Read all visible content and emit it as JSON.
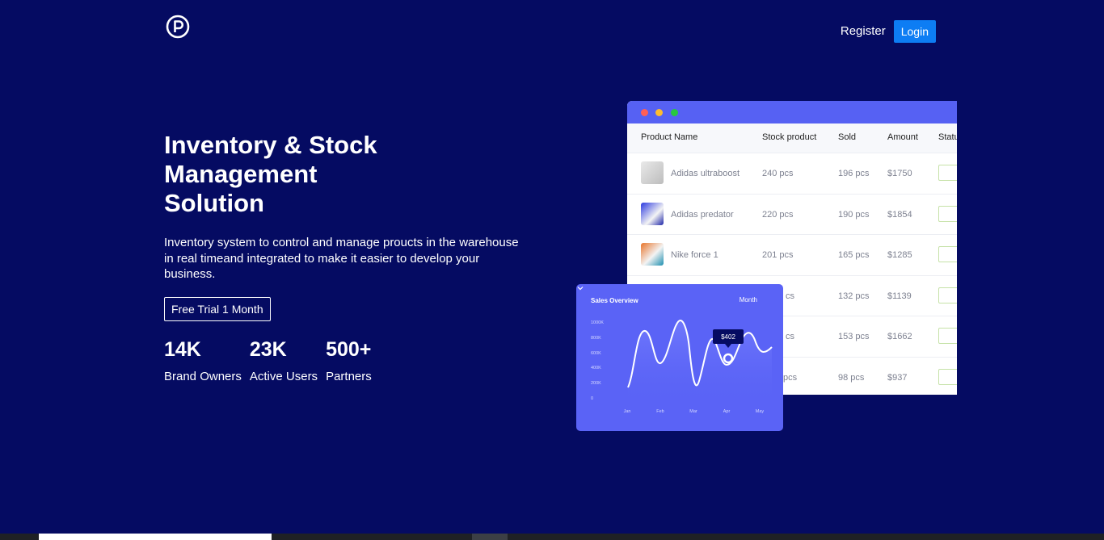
{
  "brand": {
    "logo_icon": "p-circle-logo-icon"
  },
  "nav": {
    "register": "Register",
    "login": "Login"
  },
  "hero": {
    "title": "Inventory & Stock Management Solution",
    "description": "Inventory system to control and manage proucts in the warehouse in real timeand integrated to make it easier to develop your business.",
    "cta": "Free Trial 1 Month"
  },
  "stats": [
    {
      "value": "14K",
      "label": "Brand Owners"
    },
    {
      "value": "23K",
      "label": "Active Users"
    },
    {
      "value": "500+",
      "label": "Partners"
    }
  ],
  "product_table": {
    "window_dots": [
      "#ff5f57",
      "#febc2e",
      "#28c840"
    ],
    "columns": [
      "Product Name",
      "Stock product",
      "Sold",
      "Amount",
      "Status"
    ],
    "rows": [
      {
        "name": "Adidas ultraboost",
        "stock": "240 pcs",
        "sold": "196 pcs",
        "amount": "$1750"
      },
      {
        "name": "Adidas predator",
        "stock": "220 pcs",
        "sold": "190 pcs",
        "amount": "$1854"
      },
      {
        "name": "Nike force 1",
        "stock": "201 pcs",
        "sold": "165 pcs",
        "amount": "$1285"
      },
      {
        "name": "",
        "stock": "cs",
        "sold": "132 pcs",
        "amount": "$1139"
      },
      {
        "name": "",
        "stock": "cs",
        "sold": "153 pcs",
        "amount": "$1662"
      },
      {
        "name": "",
        "stock": "pcs",
        "sold": "98 pcs",
        "amount": "$937"
      }
    ]
  },
  "sales_overview": {
    "title": "Sales Overview",
    "period": "Month",
    "tooltip": "$402",
    "y_ticks": [
      "1000K",
      "800K",
      "600K",
      "400K",
      "200K",
      "0"
    ],
    "x_ticks": [
      "Jan",
      "Feb",
      "Mar",
      "Apr",
      "May"
    ]
  }
}
